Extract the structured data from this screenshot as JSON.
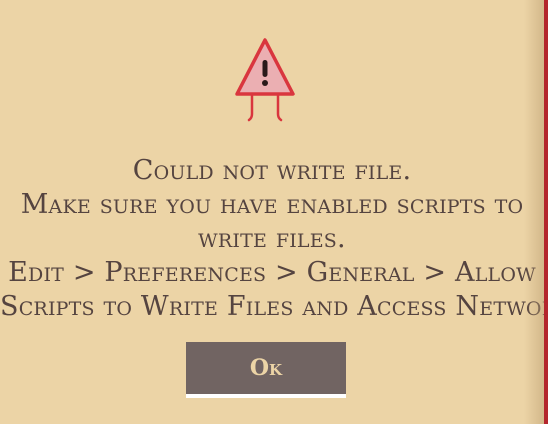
{
  "dialog": {
    "icon": "warning-triangle-icon",
    "lines": [
      "Could not write file.",
      "Make sure you have enabled scripts to",
      "write files.",
      "Edit > Preferences > General > Allow",
      "Scripts to Write Files and Access Network"
    ],
    "ok_label": "Ok"
  },
  "colors": {
    "background": "#ecd4a6",
    "text": "#554440",
    "button": "#716462",
    "accent": "#d9363e",
    "edge": "#b3262d"
  }
}
